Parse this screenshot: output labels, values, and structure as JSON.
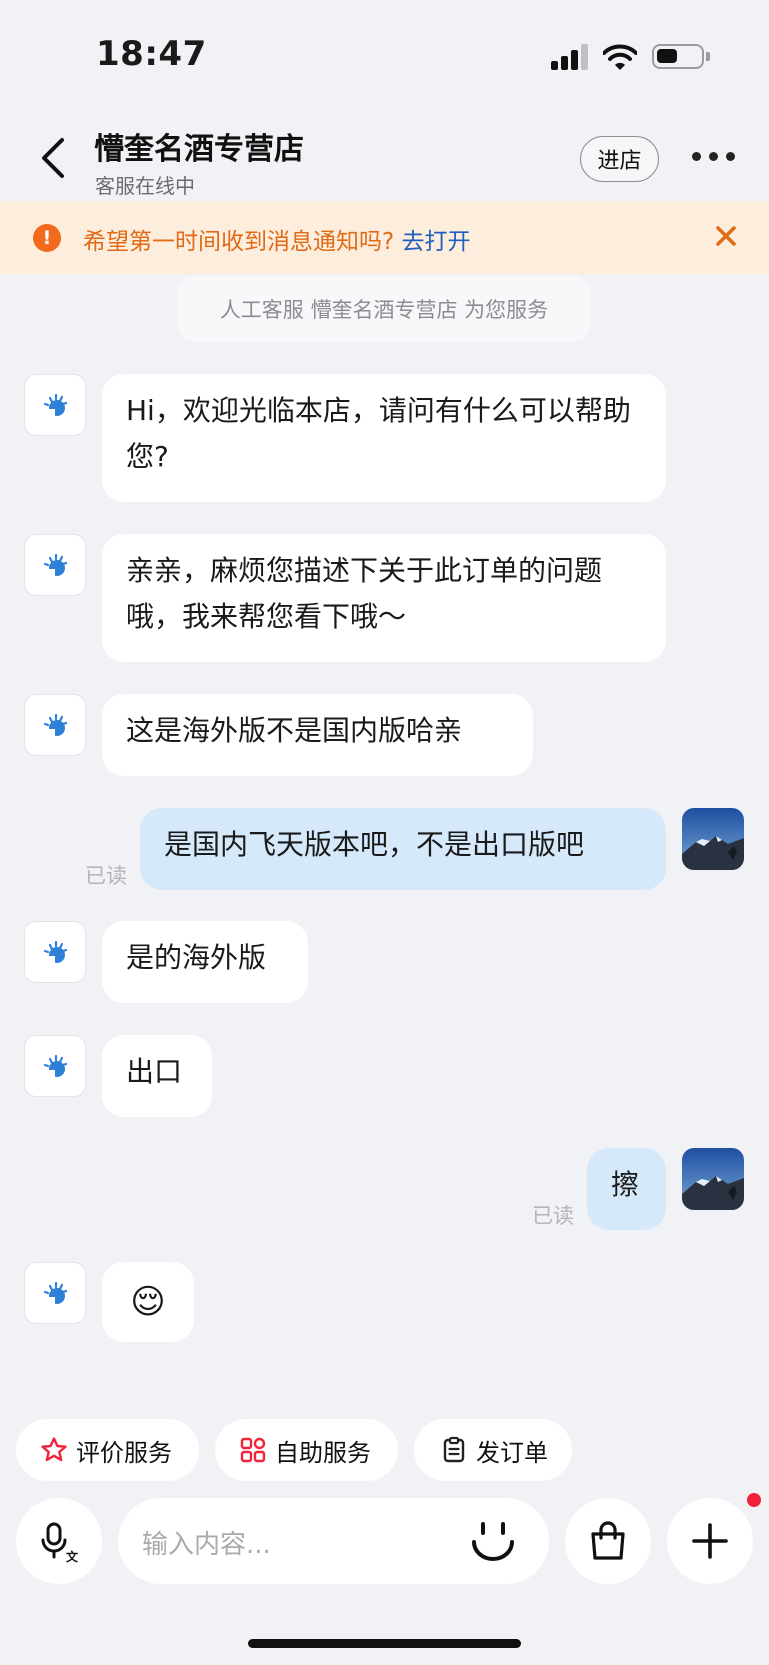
{
  "status_bar": {
    "time": "18:47"
  },
  "header": {
    "title": "懵奎名酒专营店",
    "subtitle": "客服在线中",
    "enter_store_label": "进店"
  },
  "notice": {
    "text": "希望第一时间收到消息通知吗?",
    "link": "去打开"
  },
  "system_message": "人工客服 懵奎名酒专营店 为您服务",
  "messages": [
    {
      "sender": "bot",
      "text": "Hi，欢迎光临本店，请问有什么可以帮助您?"
    },
    {
      "sender": "bot",
      "text": "亲亲，麻烦您描述下关于此订单的问题哦，我来帮您看下哦～"
    },
    {
      "sender": "bot",
      "text": "这是海外版不是国内版哈亲"
    },
    {
      "sender": "user",
      "text": "是国内飞天版本吧，不是出口版吧",
      "status": "已读"
    },
    {
      "sender": "bot",
      "text": "是的海外版"
    },
    {
      "sender": "bot",
      "text": "出口"
    },
    {
      "sender": "user",
      "text": "擦",
      "status": "已读"
    },
    {
      "sender": "bot",
      "text": "😌"
    }
  ],
  "quick_actions": [
    {
      "label": "评价服务"
    },
    {
      "label": "自助服务"
    },
    {
      "label": "发订单"
    }
  ],
  "composer": {
    "placeholder": "输入内容..."
  },
  "colors": {
    "accent_blue": "#1f5fbf",
    "notice_orange": "#e06a16",
    "user_bubble": "#d5e9fb",
    "background": "#f1f2f6"
  }
}
